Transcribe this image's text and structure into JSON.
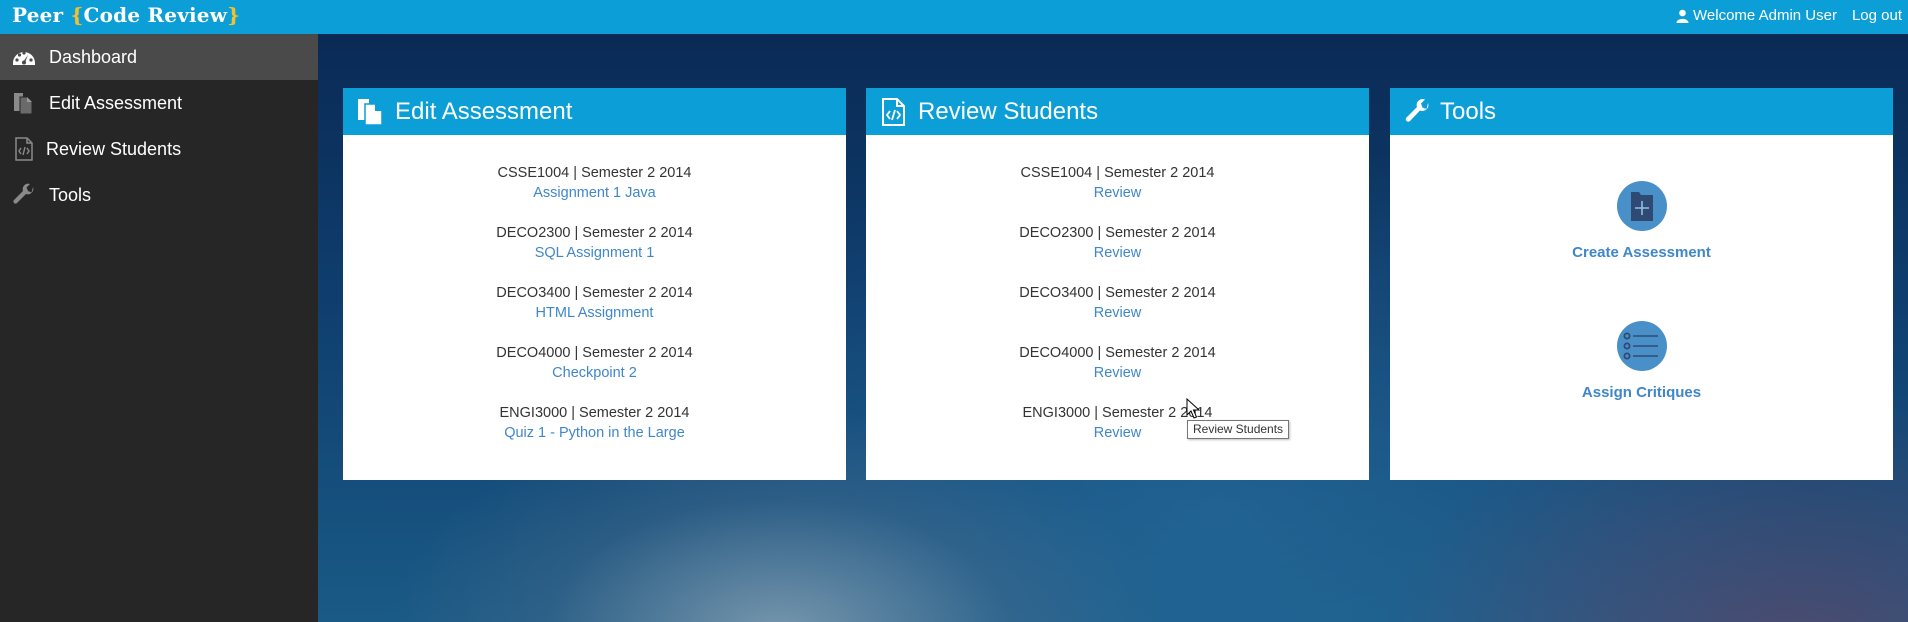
{
  "header": {
    "logo_pre": "Peer ",
    "logo_open": "{",
    "logo_mid": "Code Review",
    "logo_close": "}",
    "welcome": "Welcome Admin User",
    "logout": "Log out"
  },
  "sidebar": {
    "items": [
      {
        "label": "Dashboard",
        "icon": "dashboard-icon",
        "active": true
      },
      {
        "label": "Edit Assessment",
        "icon": "copy-icon"
      },
      {
        "label": "Review Students",
        "icon": "code-file-icon"
      },
      {
        "label": "Tools",
        "icon": "wrench-icon"
      }
    ]
  },
  "panels": {
    "edit": {
      "title": "Edit Assessment",
      "entries": [
        {
          "course": "CSSE1004 | Semester 2 2014",
          "link": "Assignment 1 Java"
        },
        {
          "course": "DECO2300 | Semester 2 2014",
          "link": "SQL Assignment 1"
        },
        {
          "course": "DECO3400 | Semester 2 2014",
          "link": "HTML Assignment"
        },
        {
          "course": "DECO4000 | Semester 2 2014",
          "link": "Checkpoint 2"
        },
        {
          "course": "ENGI3000 | Semester 2 2014",
          "link": "Quiz 1 - Python in the Large"
        }
      ]
    },
    "review": {
      "title": "Review Students",
      "entries": [
        {
          "course": "CSSE1004 | Semester 2 2014",
          "link": "Review"
        },
        {
          "course": "DECO2300 | Semester 2 2014",
          "link": "Review"
        },
        {
          "course": "DECO3400 | Semester 2 2014",
          "link": "Review"
        },
        {
          "course": "DECO4000 | Semester 2 2014",
          "link": "Review"
        },
        {
          "course": "ENGI3000 | Semester 2 2014",
          "link": "Review"
        }
      ]
    },
    "tools": {
      "title": "Tools",
      "create_label": "Create Assessment",
      "assign_label": "Assign Critiques"
    }
  },
  "tooltip": {
    "text": "Review Students"
  },
  "colors": {
    "topbar": "#0c9ed7",
    "sidebar": "#262626",
    "sidebar_active": "#4a4a4a",
    "link": "#3f87c9",
    "logo_brace": "#f2c12e",
    "tool_icon": "#4a90c8"
  }
}
